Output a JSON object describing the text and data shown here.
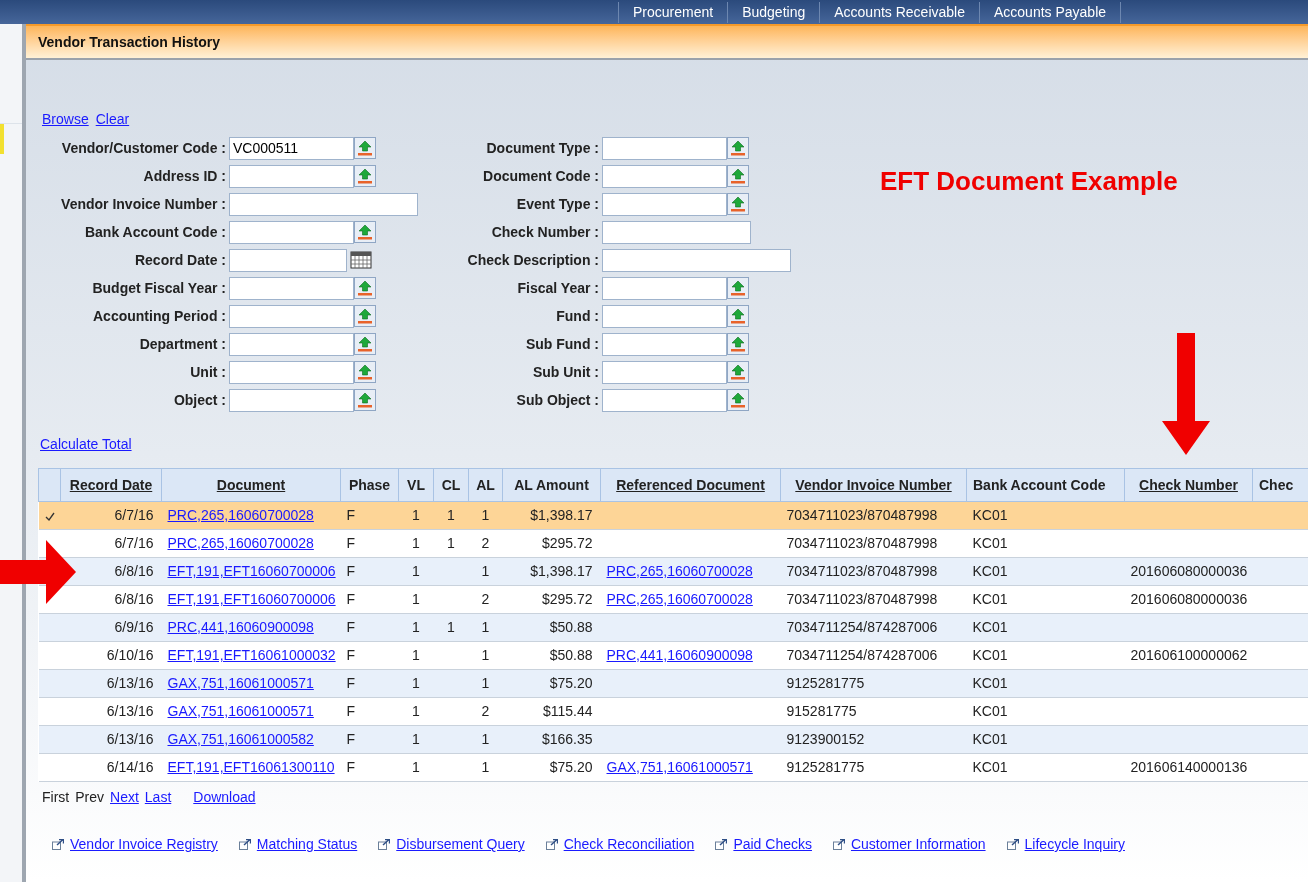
{
  "top_nav": [
    {
      "label": "Procurement"
    },
    {
      "label": "Budgeting"
    },
    {
      "label": "Accounts Receivable"
    },
    {
      "label": "Accounts Payable"
    }
  ],
  "page_title": "Vendor Transaction History",
  "form_actions": [
    "Browse",
    "Clear"
  ],
  "form_left": [
    {
      "label": "Vendor/Customer Code :",
      "value": "VC000511",
      "kind": "lookup"
    },
    {
      "label": "Address ID :",
      "kind": "lookup"
    },
    {
      "label": "Vendor Invoice Number :",
      "kind": "wide"
    },
    {
      "label": "Bank Account Code :",
      "kind": "lookup"
    },
    {
      "label": "Record Date :",
      "kind": "date"
    },
    {
      "label": "Budget Fiscal Year :",
      "kind": "lookup"
    },
    {
      "label": "Accounting Period :",
      "kind": "lookup"
    },
    {
      "label": "Department :",
      "kind": "lookup"
    },
    {
      "label": "Unit :",
      "kind": "lookup"
    },
    {
      "label": "Object :",
      "kind": "lookup"
    }
  ],
  "form_right": [
    {
      "label": "Document Type :",
      "kind": "lookup"
    },
    {
      "label": "Document Code :",
      "kind": "lookup"
    },
    {
      "label": "Event Type :",
      "kind": "lookup"
    },
    {
      "label": "Check Number :",
      "kind": "text"
    },
    {
      "label": "Check Description :",
      "kind": "wide"
    },
    {
      "label": "Fiscal Year :",
      "kind": "lookup"
    },
    {
      "label": "Fund :",
      "kind": "lookup"
    },
    {
      "label": "Sub Fund :",
      "kind": "lookup"
    },
    {
      "label": "Sub Unit :",
      "kind": "lookup"
    },
    {
      "label": "Sub Object :",
      "kind": "lookup"
    }
  ],
  "annotation": "EFT Document Example",
  "calculate_total": "Calculate Total",
  "table": {
    "columns": [
      {
        "label": "Record Date",
        "sortable": true,
        "kind": "text"
      },
      {
        "label": "Document",
        "sortable": true,
        "kind": "link"
      },
      {
        "label": "Phase",
        "sortable": false,
        "kind": "text"
      },
      {
        "label": "VL",
        "sortable": false,
        "kind": "text"
      },
      {
        "label": "CL",
        "sortable": false,
        "kind": "text"
      },
      {
        "label": "AL",
        "sortable": false,
        "kind": "text"
      },
      {
        "label": "AL Amount",
        "sortable": false,
        "kind": "text"
      },
      {
        "label": "Referenced Document",
        "sortable": true,
        "kind": "link"
      },
      {
        "label": "Vendor Invoice Number",
        "sortable": true,
        "kind": "text"
      },
      {
        "label": "Bank Account Code",
        "sortable": false,
        "kind": "text"
      },
      {
        "label": "Check Number",
        "sortable": true,
        "kind": "text"
      },
      {
        "label": "Chec",
        "sortable": false
      }
    ],
    "rows": [
      {
        "selected": true,
        "cells": [
          "6/7/16",
          "PRC,265,16060700028",
          "F",
          "1",
          "1",
          "1",
          "$1,398.17",
          null,
          "7034711023/870487998",
          "KC01",
          null,
          null
        ]
      },
      {
        "selected": false,
        "cells": [
          "6/7/16",
          "PRC,265,16060700028",
          "F",
          "1",
          "1",
          "2",
          "$295.72",
          null,
          "7034711023/870487998",
          "KC01",
          null,
          null
        ]
      },
      {
        "selected": false,
        "cells": [
          "6/8/16",
          "EFT,191,EFT16060700006",
          "F",
          "1",
          null,
          "1",
          "$1,398.17",
          "PRC,265,16060700028",
          "7034711023/870487998",
          "KC01",
          "201606080000036",
          null
        ]
      },
      {
        "selected": false,
        "cells": [
          "6/8/16",
          "EFT,191,EFT16060700006",
          "F",
          "1",
          null,
          "2",
          "$295.72",
          "PRC,265,16060700028",
          "7034711023/870487998",
          "KC01",
          "201606080000036",
          null
        ]
      },
      {
        "selected": false,
        "cells": [
          "6/9/16",
          "PRC,441,16060900098",
          "F",
          "1",
          "1",
          "1",
          "$50.88",
          null,
          "7034711254/874287006",
          "KC01",
          null,
          null
        ]
      },
      {
        "selected": false,
        "cells": [
          "6/10/16",
          "EFT,191,EFT16061000032",
          "F",
          "1",
          null,
          "1",
          "$50.88",
          "PRC,441,16060900098",
          "7034711254/874287006",
          "KC01",
          "201606100000062",
          null
        ]
      },
      {
        "selected": false,
        "cells": [
          "6/13/16",
          "GAX,751,16061000571",
          "F",
          "1",
          null,
          "1",
          "$75.20",
          null,
          "9125281775",
          "KC01",
          null,
          null
        ]
      },
      {
        "selected": false,
        "cells": [
          "6/13/16",
          "GAX,751,16061000571",
          "F",
          "1",
          null,
          "2",
          "$115.44",
          null,
          "915281775",
          "KC01",
          null,
          null
        ]
      },
      {
        "selected": false,
        "cells": [
          "6/13/16",
          "GAX,751,16061000582",
          "F",
          "1",
          null,
          "1",
          "$166.35",
          null,
          "9123900152",
          "KC01",
          null,
          null
        ]
      },
      {
        "selected": false,
        "cells": [
          "6/14/16",
          "EFT,191,EFT16061300110",
          "F",
          "1",
          null,
          "1",
          "$75.20",
          "GAX,751,16061000571",
          "9125281775",
          "KC01",
          "201606140000136",
          null
        ]
      }
    ]
  },
  "pager": [
    {
      "label": "First",
      "enabled": false
    },
    {
      "label": "Prev",
      "enabled": false
    },
    {
      "label": "Next",
      "enabled": true
    },
    {
      "label": "Last",
      "enabled": true
    }
  ],
  "download": "Download",
  "related_links": [
    {
      "label": "Vendor Invoice Registry"
    },
    {
      "label": "Matching Status"
    },
    {
      "label": "Disbursement Query"
    },
    {
      "label": "Check Reconciliation"
    },
    {
      "label": "Paid Checks"
    },
    {
      "label": "Customer Information"
    },
    {
      "label": "Lifecycle Inquiry"
    }
  ]
}
